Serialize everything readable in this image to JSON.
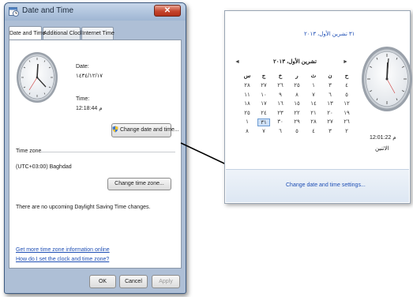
{
  "dialog": {
    "title": "Date and Time",
    "close_glyph": "✕",
    "tabs": [
      "Date and Time",
      "Additional Clocks",
      "Internet Time"
    ],
    "date_label": "Date:",
    "date_value": "١٤٣٤/١٢/١٧",
    "time_label": "Time:",
    "time_value": "12:18:44 م",
    "change_datetime_button": "Change date and time...",
    "timezone_heading": "Time zone",
    "timezone_value": "(UTC+03:00) Baghdad",
    "change_timezone_button": "Change time zone...",
    "dst_text": "There are no upcoming Daylight Saving Time changes.",
    "link_more_info": "Get more time zone information online",
    "link_howto": "How do I set the clock and time zone?",
    "ok_button": "OK",
    "cancel_button": "Cancel",
    "apply_button": "Apply",
    "icons": {
      "title": "calendar-clock-icon",
      "shield": "uac-shield-icon"
    }
  },
  "popup": {
    "long_date": "٣١ تشرين الأول، ٢٠١٣",
    "month_year": "تشرين الأول، ٢٠١٣",
    "prev_glyph": "◄",
    "next_glyph": "►",
    "weekdays": [
      "س",
      "ج",
      "خ",
      "ر",
      "ث",
      "ن",
      "ح"
    ],
    "weeks": [
      [
        "٢٨",
        "٢٧",
        "٢٦",
        "٢٥",
        "١",
        "٣",
        "٤"
      ],
      [
        "١١",
        "١٠",
        "٩",
        "٨",
        "٧",
        "٦",
        "٥"
      ],
      [
        "١٨",
        "١٧",
        "١٦",
        "١٥",
        "١٤",
        "١٣",
        "١٢"
      ],
      [
        "٢٥",
        "٢٤",
        "٢٣",
        "٢٢",
        "٢١",
        "٢٠",
        "١٩"
      ],
      [
        "١",
        "٣١",
        "٣٠",
        "٢٩",
        "٢٨",
        "٢٧",
        "٢٦"
      ],
      [
        "٨",
        "٧",
        "٦",
        "٥",
        "٤",
        "٣",
        "٢"
      ]
    ],
    "selected_day": "٣١",
    "time_value": "12:01:22 م",
    "weekday_name": "الاثنين",
    "settings_link": "Change date and time settings..."
  },
  "colors": {
    "title_bar": "#aebfd6",
    "close_button": "#c5452d",
    "link": "#1f4fb5",
    "footer": "#dde7f3"
  }
}
